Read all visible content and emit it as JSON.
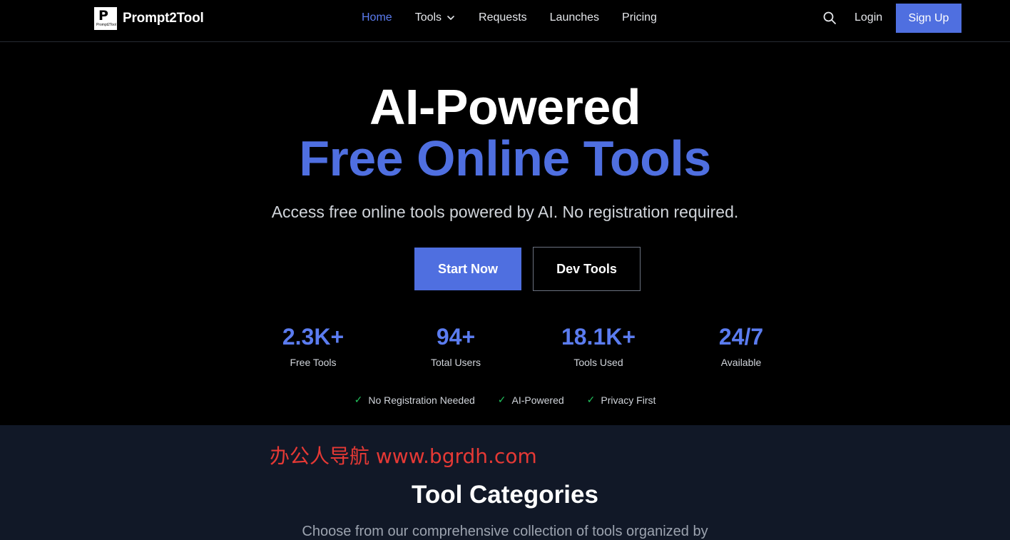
{
  "brand": {
    "name": "Prompt2Tool",
    "logo_letters": "P",
    "logo_small_text": "Prompt2Tool"
  },
  "nav": {
    "items": [
      {
        "label": "Home",
        "active": true
      },
      {
        "label": "Tools",
        "has_dropdown": true
      },
      {
        "label": "Requests"
      },
      {
        "label": "Launches"
      },
      {
        "label": "Pricing"
      }
    ],
    "login_label": "Login",
    "signup_label": "Sign Up"
  },
  "hero": {
    "title_line1": "AI-Powered",
    "title_line2": "Free Online Tools",
    "subtitle": "Access free online tools powered by AI. No registration required.",
    "primary_button": "Start Now",
    "secondary_button": "Dev Tools",
    "stats": [
      {
        "value": "2.3K+",
        "label": "Free Tools"
      },
      {
        "value": "94+",
        "label": "Total Users"
      },
      {
        "value": "18.1K+",
        "label": "Tools Used"
      },
      {
        "value": "24/7",
        "label": "Available"
      }
    ],
    "features": [
      "No Registration Needed",
      "AI-Powered",
      "Privacy First"
    ],
    "check_glyph": "✓"
  },
  "categories": {
    "watermark": "办公人导航  www.bgrdh.com",
    "title": "Tool Categories",
    "subtitle": "Choose from our comprehensive collection of tools organized by"
  },
  "colors": {
    "accent": "#4f6fe0",
    "accent_text": "#5b7cf0",
    "check": "#22c55e",
    "section_bg": "#111827",
    "watermark": "#e53935"
  }
}
